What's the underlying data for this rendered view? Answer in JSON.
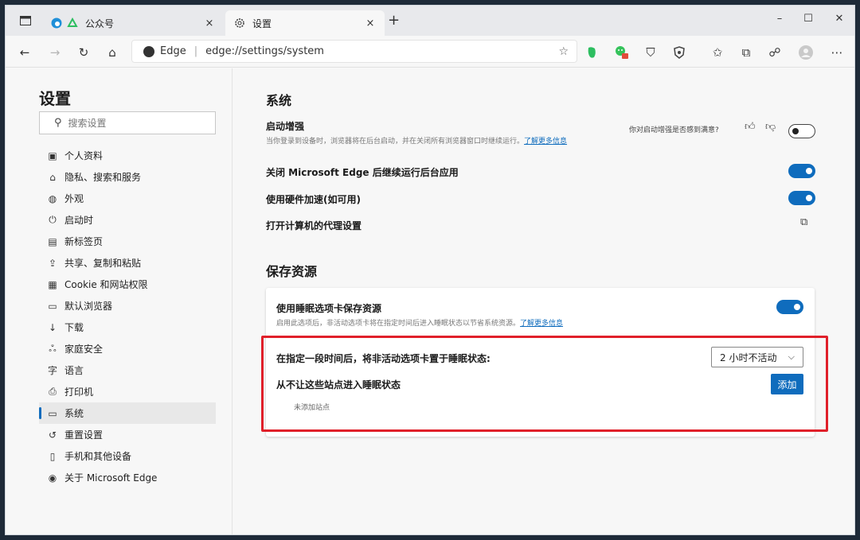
{
  "tabs": [
    {
      "title": "公众号",
      "close": "×",
      "active": false
    },
    {
      "title": "设置",
      "close": "×",
      "active": true
    }
  ],
  "newtab": "+",
  "window_controls": {
    "minimize": "–",
    "maximize": "☐",
    "close": "✕"
  },
  "address": {
    "brand": "Edge",
    "separator": "|",
    "url": "edge://settings/system"
  },
  "colors": {
    "accent": "#0f6cbd",
    "highlight_border": "#e0202a",
    "evernote_green": "#2dbe60",
    "wechat_green": "#35c35b"
  },
  "sidebar": {
    "title": "设置",
    "search_placeholder": "搜索设置",
    "items": [
      {
        "icon": "profile-icon",
        "glyph": "▣",
        "label": "个人资料"
      },
      {
        "icon": "lock-icon",
        "glyph": "⌂",
        "label": "隐私、搜索和服务"
      },
      {
        "icon": "palette-icon",
        "glyph": "◍",
        "label": "外观"
      },
      {
        "icon": "power-icon",
        "glyph": "⏻",
        "label": "启动时"
      },
      {
        "icon": "newtab-icon",
        "glyph": "▤",
        "label": "新标签页"
      },
      {
        "icon": "share-icon",
        "glyph": "⇪",
        "label": "共享、复制和粘贴"
      },
      {
        "icon": "cookie-icon",
        "glyph": "▦",
        "label": "Cookie 和网站权限"
      },
      {
        "icon": "browser-icon",
        "glyph": "▭",
        "label": "默认浏览器"
      },
      {
        "icon": "download-icon",
        "glyph": "↓",
        "label": "下载"
      },
      {
        "icon": "family-icon",
        "glyph": "ஃ",
        "label": "家庭安全"
      },
      {
        "icon": "language-icon",
        "glyph": "字",
        "label": "语言"
      },
      {
        "icon": "printer-icon",
        "glyph": "⎙",
        "label": "打印机"
      },
      {
        "icon": "system-icon",
        "glyph": "▭",
        "label": "系统",
        "active": true
      },
      {
        "icon": "reset-icon",
        "glyph": "↺",
        "label": "重置设置"
      },
      {
        "icon": "phone-icon",
        "glyph": "▯",
        "label": "手机和其他设备"
      },
      {
        "icon": "edge-icon",
        "glyph": "◉",
        "label": "关于 Microsoft Edge"
      }
    ]
  },
  "system": {
    "title": "系统",
    "startup_boost": {
      "title": "启动增强",
      "desc": "当你登录到设备时，浏览器将在后台启动，并在关闭所有浏览器窗口时继续运行。",
      "link": "了解更多信息",
      "feedback": "你对启动增强是否感到满意?",
      "state": "off"
    },
    "background_apps": {
      "title": "关闭 Microsoft Edge 后继续运行后台应用",
      "state": "on"
    },
    "hardware_accel": {
      "title": "使用硬件加速(如可用)",
      "state": "on"
    },
    "proxy": {
      "title": "打开计算机的代理设置"
    }
  },
  "save_resources": {
    "title": "保存资源",
    "sleeping_tabs": {
      "title": "使用睡眠选项卡保存资源",
      "desc": "启用此选项后，非活动选项卡将在指定时间后进入睡眠状态以节省系统资源。",
      "link": "了解更多信息",
      "state": "on"
    },
    "sleep_after": {
      "label": "在指定一段时间后，将非活动选项卡置于睡眠状态:",
      "value": "2 小时不活动"
    },
    "never_sleep": {
      "label": "从不让这些站点进入睡眠状态",
      "button": "添加",
      "empty": "未添加站点"
    }
  }
}
